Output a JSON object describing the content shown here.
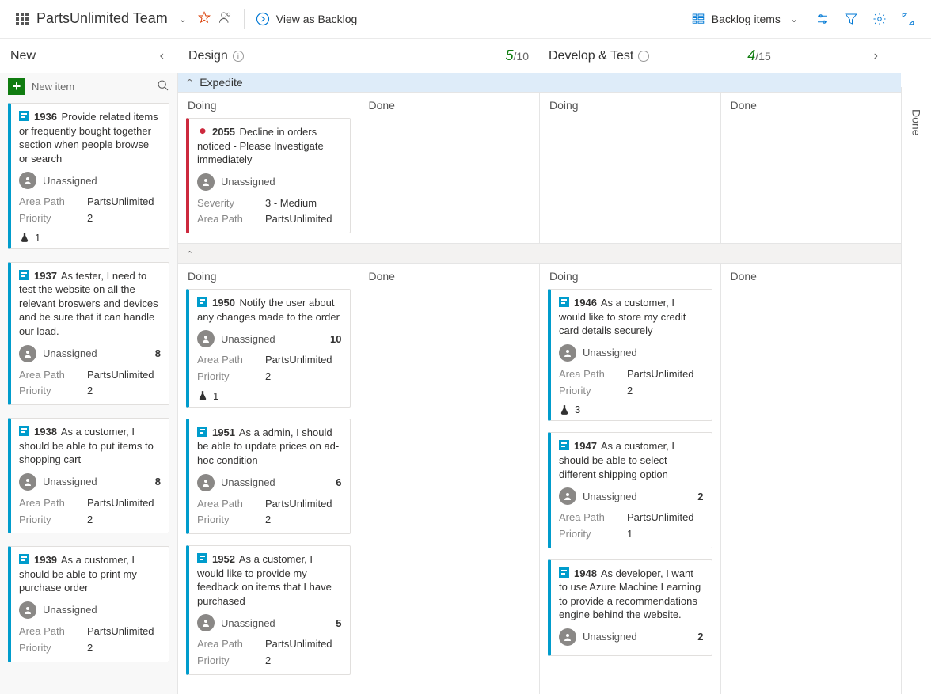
{
  "header": {
    "team_name": "PartsUnlimited Team",
    "view_as_backlog": "View as Backlog",
    "backlog_items": "Backlog items"
  },
  "columns": {
    "new": {
      "title": "New"
    },
    "design": {
      "title": "Design",
      "wip_current": "5",
      "wip_limit": "/10"
    },
    "dev": {
      "title": "Develop & Test",
      "wip_current": "4",
      "wip_limit": "/15"
    },
    "done_side": "Done"
  },
  "swimlanes": {
    "expedite": "Expedite",
    "sub_doing": "Doing",
    "sub_done": "Done"
  },
  "newcol": {
    "new_item": "New item",
    "cards": [
      {
        "id": "1936",
        "title": "Provide related items or frequently bought together section when people browse or search",
        "assignee": "Unassigned",
        "area": "PartsUnlimited",
        "priority": "2",
        "flask": "1"
      },
      {
        "id": "1937",
        "title": "As tester, I need to test the website on all the relevant broswers and devices and be sure that it can handle our load.",
        "assignee": "Unassigned",
        "area": "PartsUnlimited",
        "priority": "2",
        "effort": "8"
      },
      {
        "id": "1938",
        "title": "As a customer, I should be able to put items to shopping cart",
        "assignee": "Unassigned",
        "area": "PartsUnlimited",
        "priority": "2",
        "effort": "8"
      },
      {
        "id": "1939",
        "title": "As a customer, I should be able to print my purchase order",
        "assignee": "Unassigned",
        "area": "PartsUnlimited",
        "priority": "2"
      }
    ]
  },
  "expedite_design_doing": [
    {
      "type": "bug",
      "id": "2055",
      "title": "Decline in orders noticed - Please Investigate immediately",
      "assignee": "Unassigned",
      "severity_label": "Severity",
      "severity": "3 - Medium",
      "area": "PartsUnlimited"
    }
  ],
  "design_doing": [
    {
      "id": "1950",
      "title": "Notify the user about any changes made to the order",
      "assignee": "Unassigned",
      "area": "PartsUnlimited",
      "priority": "2",
      "effort": "10",
      "flask": "1"
    },
    {
      "id": "1951",
      "title": "As a admin, I should be able to update prices on ad-hoc condition",
      "assignee": "Unassigned",
      "area": "PartsUnlimited",
      "priority": "2",
      "effort": "6"
    },
    {
      "id": "1952",
      "title": "As a customer, I would like to provide my feedback on items that I have purchased",
      "assignee": "Unassigned",
      "area": "PartsUnlimited",
      "priority": "2",
      "effort": "5"
    }
  ],
  "dev_doing": [
    {
      "id": "1946",
      "title": "As a customer, I would like to store my credit card details securely",
      "assignee": "Unassigned",
      "area": "PartsUnlimited",
      "priority": "2",
      "flask": "3"
    },
    {
      "id": "1947",
      "title": "As a customer, I should be able to select different shipping option",
      "assignee": "Unassigned",
      "area": "PartsUnlimited",
      "priority": "1",
      "effort": "2"
    },
    {
      "id": "1948",
      "title": "As developer, I want to use Azure Machine Learning to provide a recommendations engine behind the website.",
      "assignee": "Unassigned",
      "effort": "2"
    }
  ],
  "labels": {
    "area": "Area Path",
    "priority": "Priority"
  }
}
